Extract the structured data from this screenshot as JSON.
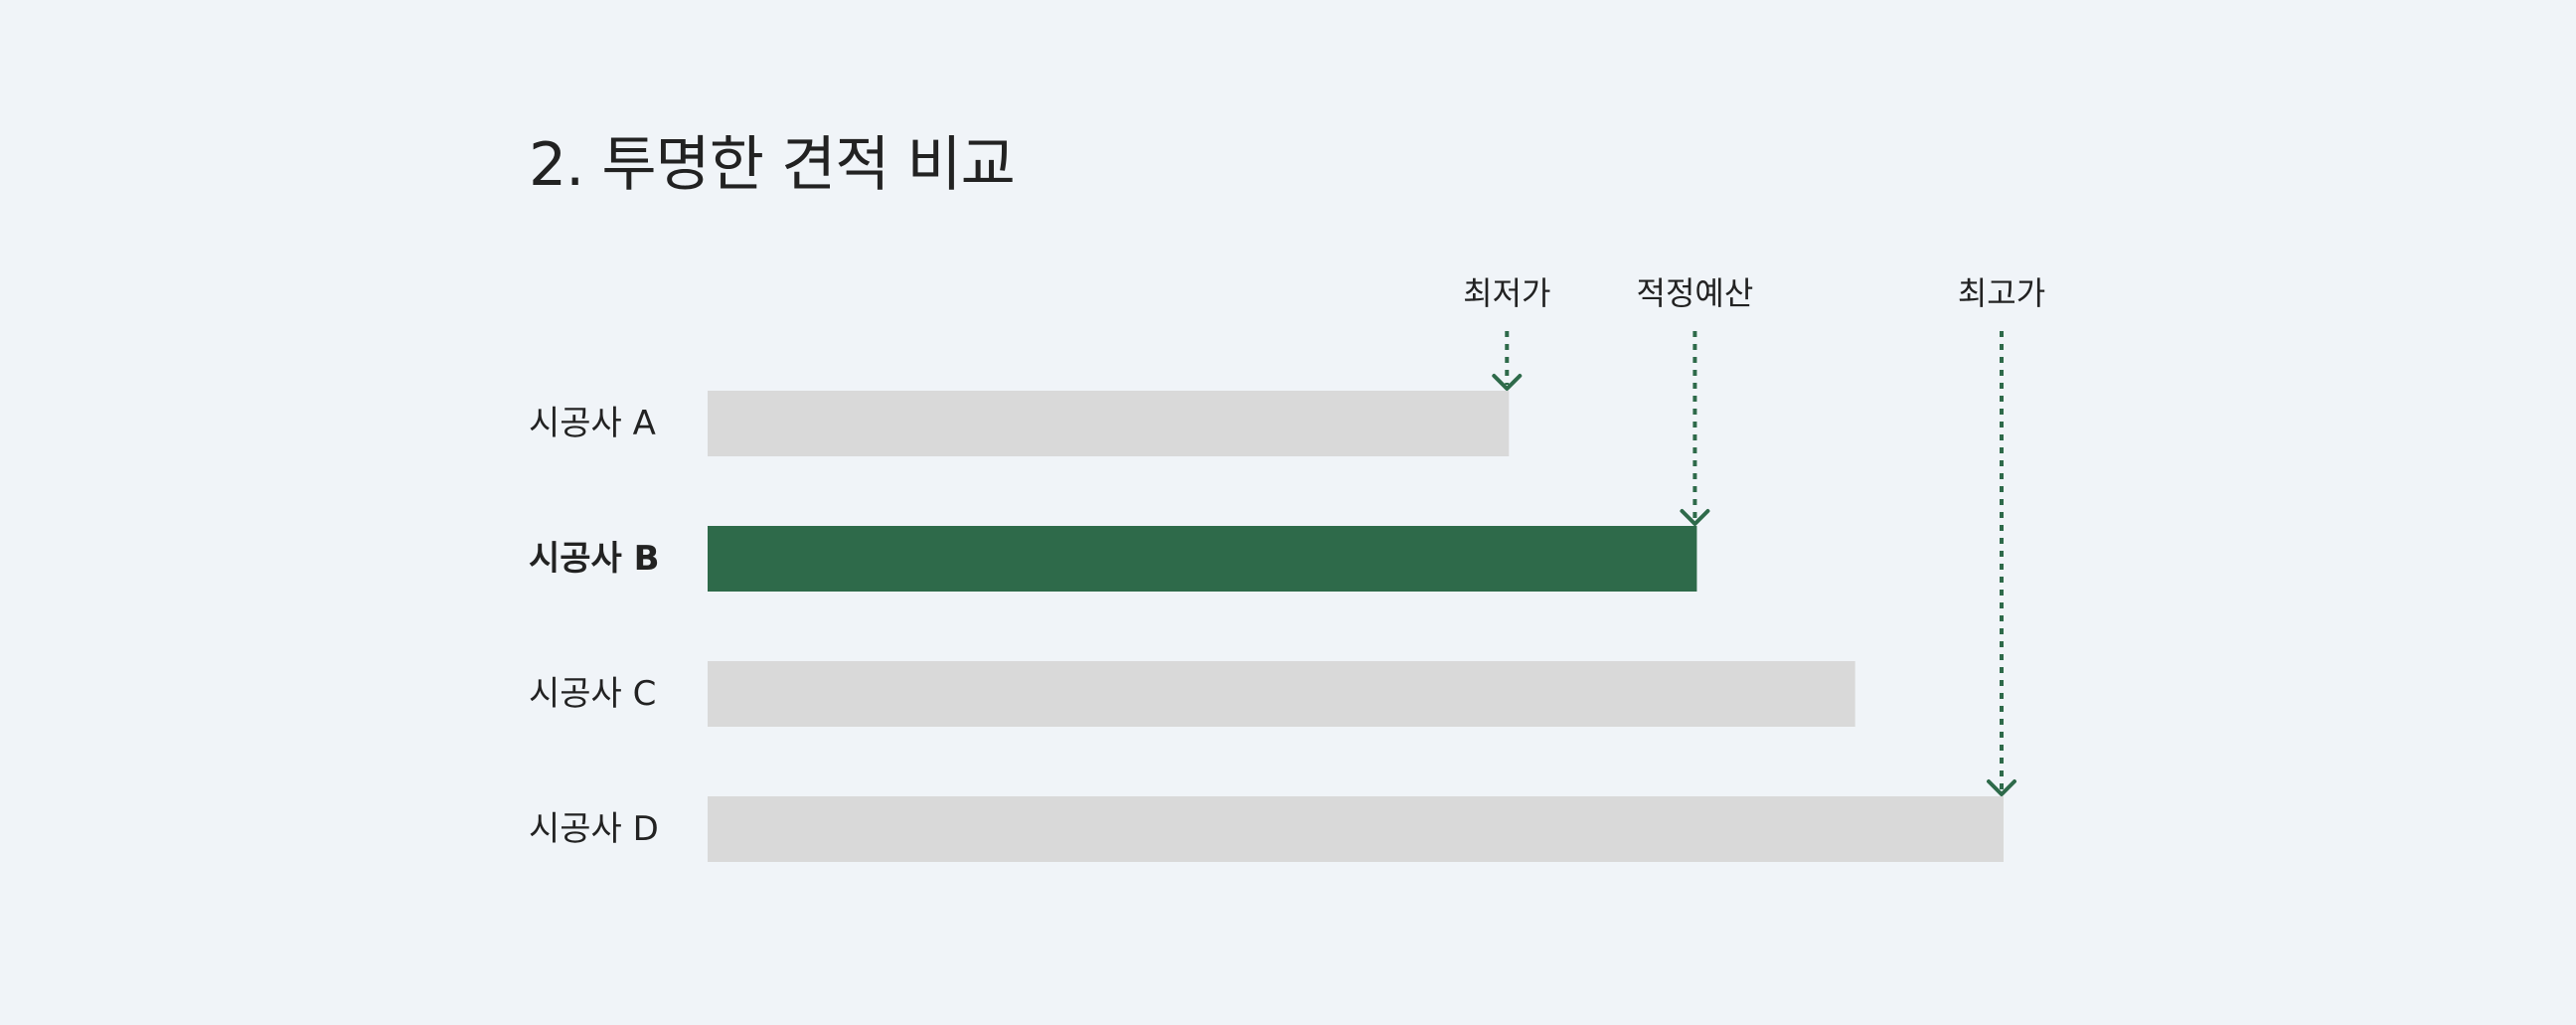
{
  "title": "2. 투명한 견적 비교",
  "colors": {
    "background": "#f0f4f8",
    "highlight": "#2e6a4a",
    "neutral": "#d9d9d9",
    "text": "#222222"
  },
  "chart_data": {
    "type": "bar",
    "orientation": "horizontal",
    "title": "2. 투명한 견적 비교",
    "xlabel": "",
    "ylabel": "",
    "grid": false,
    "x_axis_visible": false,
    "categories": [
      "시공사 A",
      "시공사 B",
      "시공사 C",
      "시공사 D"
    ],
    "values": [
      81,
      100,
      116,
      131
    ],
    "highlight_index": 1,
    "xlim": [
      0,
      131
    ],
    "markers": [
      {
        "label": "최저가",
        "category_index": 0
      },
      {
        "label": "적정예산",
        "category_index": 1
      },
      {
        "label": "최고가",
        "category_index": 3
      }
    ]
  }
}
